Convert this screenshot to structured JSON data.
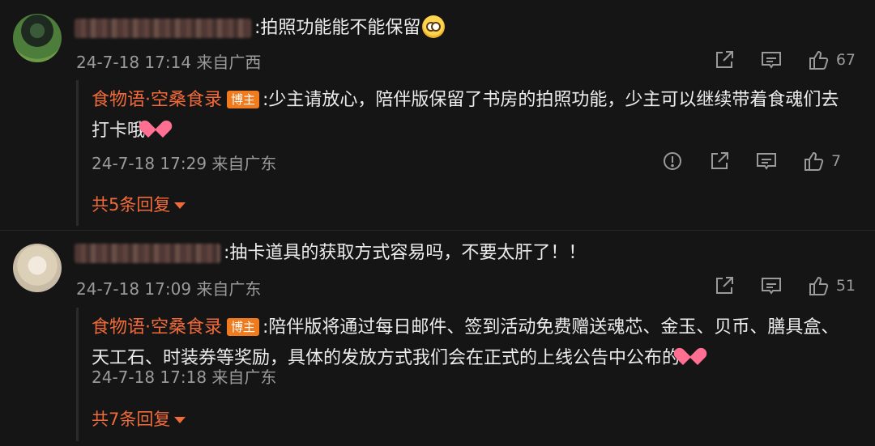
{
  "comments": [
    {
      "text": ":拍照功能能不能保留",
      "time": "24-7-18 17:14 来自广西",
      "likes": "67",
      "reply": {
        "author": "食物语·空桑食录",
        "badge": "博主",
        "text": ":少主请放心，陪伴版保留了书房的拍照功能，少主可以继续带着食魂们去打卡哦",
        "time": "24-7-18 17:29 来自广东",
        "likes": "7"
      },
      "more_replies": "共5条回复"
    },
    {
      "text": ":抽卡道具的获取方式容易吗，不要太肝了！！",
      "time": "24-7-18 17:09 来自广东",
      "likes": "51",
      "reply": {
        "author": "食物语·空桑食录",
        "badge": "博主",
        "text": ":陪伴版将通过每日邮件、签到活动免费赠送魂芯、金玉、贝币、膳具盒、天工石、时装券等奖励，具体的发放方式我们会在正式的上线公告中公布的",
        "time": "24-7-18 17:18 来自广东"
      },
      "more_replies": "共7条回复"
    }
  ],
  "icons": {
    "share": "share-icon",
    "comment": "comment-icon",
    "like": "thumbs-up-icon",
    "report": "report-icon",
    "caret": "caret-down-icon"
  },
  "colors": {
    "background": "#151515",
    "accent": "#f06a3a",
    "badge": "#f07a1e",
    "muted": "#9a9a9a"
  }
}
